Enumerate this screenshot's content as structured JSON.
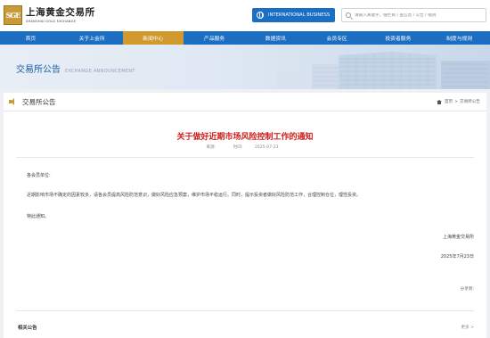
{
  "header": {
    "logo_mark": "SGE",
    "logo_cn": "上海黄金交易所",
    "logo_en": "SHANGHAI GOLD EXCHANGE",
    "intl_button": "INTERNATIONAL BUSINESS",
    "search_placeholder": "请输入关键字，搜栏目 / 查信息 / 公告 / 规则"
  },
  "nav": {
    "items": [
      "首页",
      "关于上金所",
      "新闻中心",
      "产品服务",
      "数据资讯",
      "会员专区",
      "投资者服务",
      "制度与规则"
    ],
    "active_index": 2
  },
  "banner": {
    "title_cn": "交易所公告",
    "title_en": "EXCHANGE ANNOUNCEMENT"
  },
  "panel": {
    "title": "交易所公告",
    "breadcrumb": {
      "home": "首页",
      "separator": ">",
      "current": "交易所公告"
    }
  },
  "article": {
    "title": "关于做好近期市场风险控制工作的通知",
    "source_label": "来源:",
    "time_label": "时间:",
    "time_value": "2025-07-23",
    "greeting": "各会员单位:",
    "paragraph": "近期影响市场不确定的因素较多，请各会员提高风险防范意识，做好风险应急预案，维护市场平稳运行。同时，提示投资者做好风险防范工作，合理控制仓位，理性投资。",
    "closing": "特此通知。",
    "signature_org": "上海黄金交易所",
    "signature_date": "2025年7月23日",
    "share_label": "分享到:"
  },
  "related": {
    "title": "相关公告",
    "more": "更多 >"
  },
  "colors": {
    "nav_blue": "#1b6ec2",
    "nav_active_gold": "#d29a2e",
    "title_red": "#d0201c",
    "banner_text_blue": "#1a5ca8"
  }
}
